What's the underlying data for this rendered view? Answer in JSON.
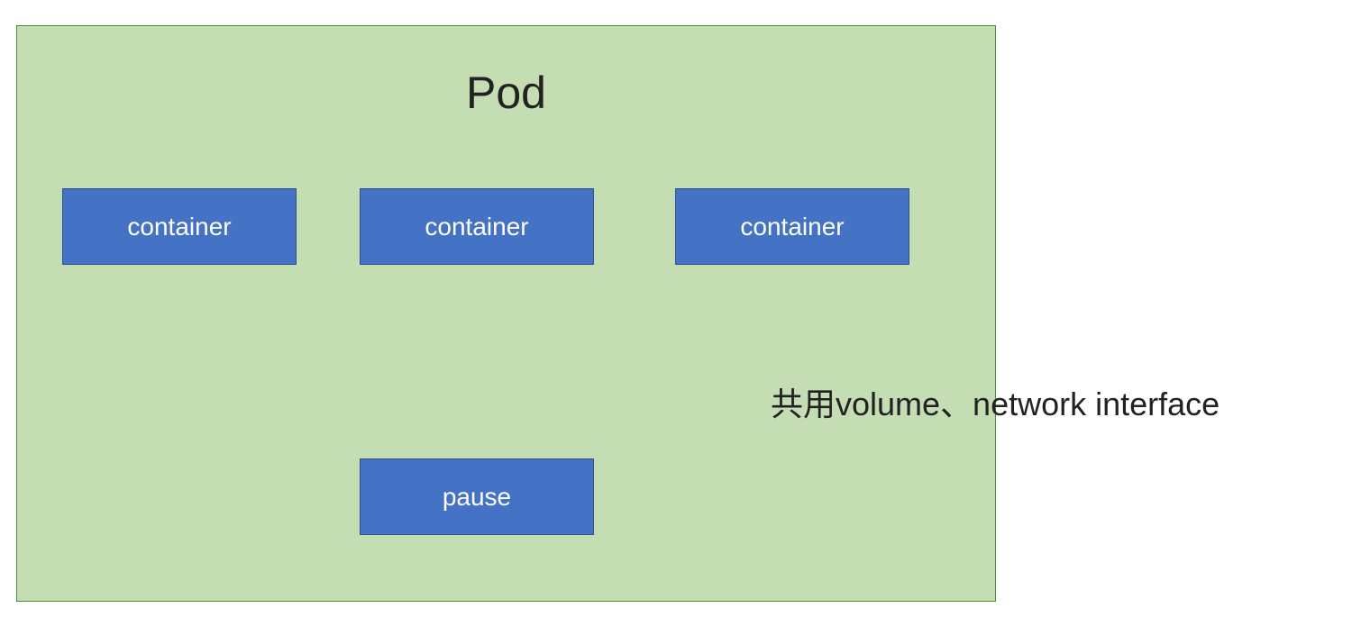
{
  "pod": {
    "title": "Pod",
    "containers": [
      "container",
      "container",
      "container"
    ],
    "pause": "pause"
  },
  "caption": "共用volume、network interface"
}
